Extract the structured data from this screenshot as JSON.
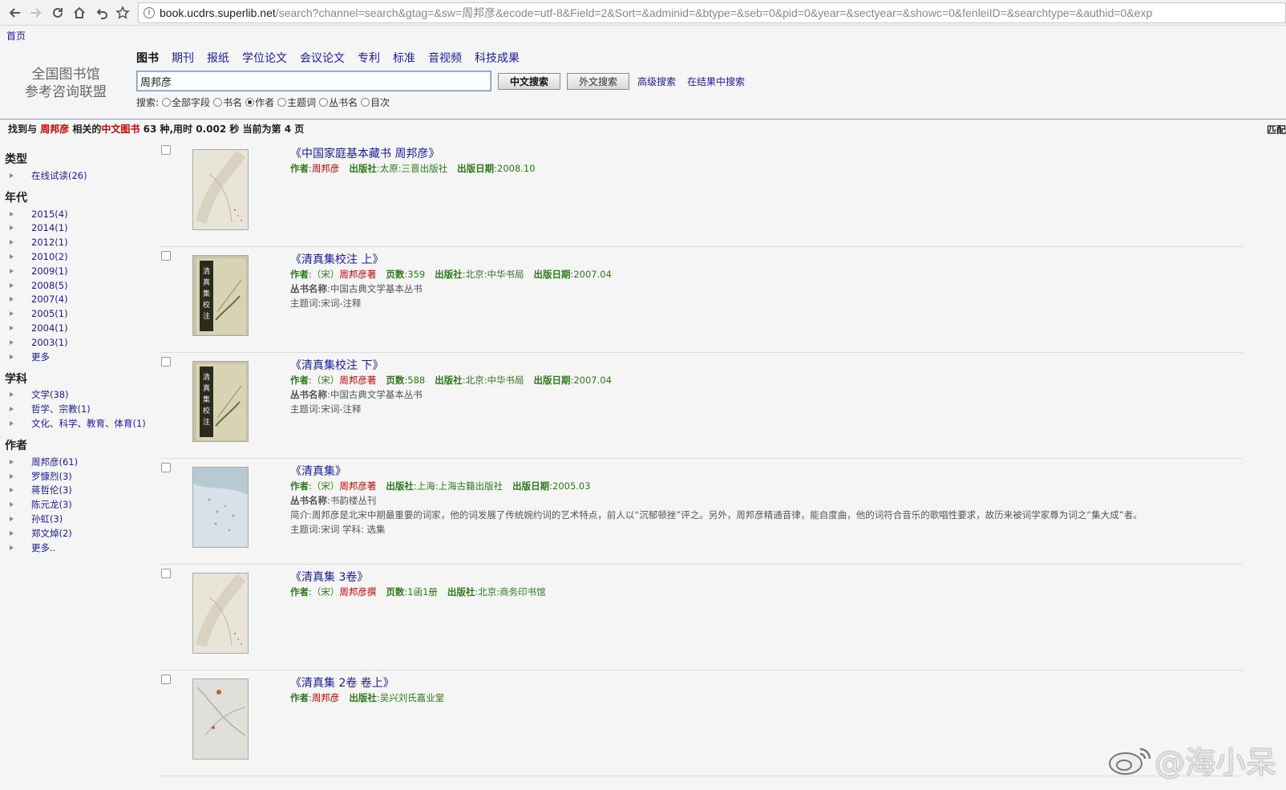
{
  "browser": {
    "url_host": "book.ucdrs.superlib.net",
    "url_rest": "/search?channel=search&gtag=&sw=周邦彦&ecode=utf-8&Field=2&Sort=&adminid=&btype=&seb=0&pid=0&year=&sectyear=&showc=0&fenleiID=&searchtype=&authid=0&exp"
  },
  "home_link": "首页",
  "logo": {
    "line1": "全国图书馆",
    "line2": "参考咨询联盟"
  },
  "channels": [
    "图书",
    "期刊",
    "报纸",
    "学位论文",
    "会议论文",
    "专利",
    "标准",
    "音视频",
    "科技成果"
  ],
  "search": {
    "value": "周邦彦",
    "btn_chinese": "中文搜索",
    "btn_foreign": "外文搜索",
    "advanced": "高级搜索",
    "in_results": "在结果中搜索",
    "scope_label": "搜索:",
    "scopes": [
      "全部字段",
      "书名",
      "作者",
      "主题词",
      "丛书名",
      "目次"
    ],
    "selected_scope": "作者"
  },
  "status": {
    "prefix": "找到与",
    "keyword": "周邦彦",
    "mid": "相关的",
    "category": "中文图书",
    "count_text": "63 种,用时 0.002 秒 当前为第 4 页",
    "right_text": "匹配"
  },
  "facets": {
    "type_title": "类型",
    "type_items": [
      "在线试读(26)"
    ],
    "year_title": "年代",
    "year_items": [
      "2015(4)",
      "2014(1)",
      "2012(1)",
      "2010(2)",
      "2009(1)",
      "2008(5)",
      "2007(4)",
      "2005(1)",
      "2004(1)",
      "2003(1)",
      "更多"
    ],
    "subject_title": "学科",
    "subject_items": [
      "文学(38)",
      "哲学、宗教(1)",
      "文化、科学、教育、体育(1)"
    ],
    "author_title": "作者",
    "author_items": [
      "周邦彦(61)",
      "罗慷烈(3)",
      "蒋哲伦(3)",
      "陈元龙(3)",
      "孙虹(3)",
      "郑文焯(2)",
      "更多.."
    ]
  },
  "labels": {
    "author": "作者",
    "publisher": "出版社",
    "pubdate": "出版日期",
    "pages": "页数",
    "series": "丛书名称",
    "subject": "主题词",
    "abstract": "简介"
  },
  "results": [
    {
      "title": "《中国家庭基本藏书 周邦彦》",
      "author_prefix": "",
      "author": "周邦彦",
      "pages": "",
      "publisher": "太原:三晋出版社",
      "pubdate": "2008.10",
      "series": "",
      "subject": "",
      "abstract": ""
    },
    {
      "title": "《清真集校注 上》",
      "author_prefix": "（宋）",
      "author": "周邦彦著",
      "pages": "359",
      "publisher": "北京:中华书局",
      "pubdate": "2007.04",
      "series": "中国古典文学基本丛书",
      "subject": "宋词-注释",
      "abstract": ""
    },
    {
      "title": "《清真集校注 下》",
      "author_prefix": "（宋）",
      "author": "周邦彦著",
      "pages": "588",
      "publisher": "北京:中华书局",
      "pubdate": "2007.04",
      "series": "中国古典文学基本丛书",
      "subject": "宋词-注释",
      "abstract": ""
    },
    {
      "title": "《清真集》",
      "author_prefix": "（宋）",
      "author": "周邦彦著",
      "pages": "",
      "publisher": "上海:上海古籍出版社",
      "pubdate": "2005.03",
      "series": "书韵楼丛刊",
      "subject": "宋词 学科: 选集",
      "abstract": "周邦彦是北宋中期最重要的词家，他的词发展了传统婉约词的艺术特点，前人以“沉郁顿挫”评之。另外，周邦彦精通音律，能自度曲，他的词符合音乐的歌唱性要求，故历来被词学家尊为词之“集大成”者。"
    },
    {
      "title": "《清真集 3卷》",
      "author_prefix": "（宋）",
      "author": "周邦彦撰",
      "pages": "1函1册",
      "publisher": "北京:商务印书馆",
      "pubdate": "",
      "series": "",
      "subject": "",
      "abstract": ""
    },
    {
      "title": "《清真集 2卷 卷上》",
      "author_prefix": "",
      "author": "周邦彦",
      "pages": "",
      "publisher": "吴兴刘氏嘉业堂",
      "pubdate": "",
      "series": "",
      "subject": "",
      "abstract": ""
    }
  ],
  "watermark": "@海小呆"
}
